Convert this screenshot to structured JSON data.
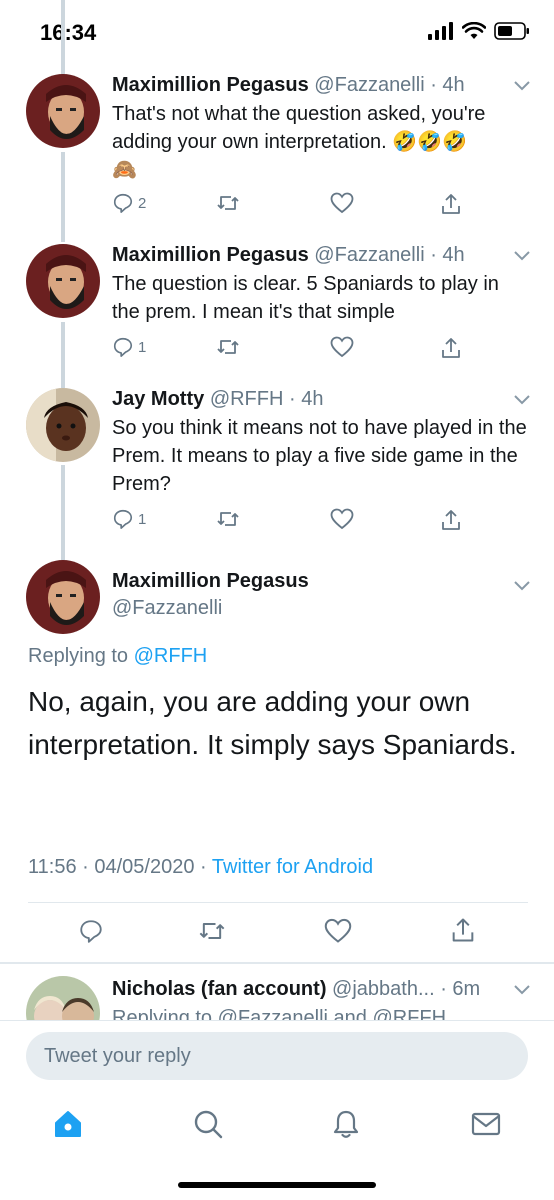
{
  "status_bar": {
    "time": "16:34"
  },
  "tweets": [
    {
      "name": "Maximillion Pegasus",
      "handle": "@Fazzanelli",
      "time": "4h",
      "text": "That's not what the question asked, you're adding your own interpretation.",
      "emoji": "🤣🤣🤣",
      "emoji2": "🙈",
      "reply_count": "2",
      "avatar_icon": "bearded-man-avatar"
    },
    {
      "name": "Maximillion Pegasus",
      "handle": "@Fazzanelli",
      "time": "4h",
      "text": "The question is clear. 5 Spaniards to play in  the prem. I mean it's that simple",
      "reply_count": "1",
      "avatar_icon": "bearded-man-avatar"
    },
    {
      "name": "Jay Motty",
      "handle": "@RFFH",
      "time": "4h",
      "text": "So you think it means not to have played in the Prem. It means to play a five side game in the Prem?",
      "reply_count": "1",
      "avatar_icon": "child-avatar"
    }
  ],
  "main_tweet": {
    "name": "Maximillion Pegasus",
    "handle": "@Fazzanelli",
    "replying_prefix": "Replying to",
    "replying_to": "@RFFH",
    "text": "No,  again, you are adding your own interpretation.  It simply says Spaniards.",
    "time": "11:56",
    "date": "04/05/2020",
    "source": "Twitter for Android"
  },
  "next_tweet": {
    "name": "Nicholas (fan account)",
    "handle": "@jabbath...",
    "time": "6m",
    "replying_text": "Replying to @Fazzanelli and @RFFH"
  },
  "reply_bar": {
    "placeholder": "Tweet your reply"
  },
  "tabs": [
    "home",
    "search",
    "notifications",
    "messages"
  ],
  "colors": {
    "accent": "#1da1f2",
    "muted": "#657786",
    "thread_line": "#ccd6dd"
  }
}
